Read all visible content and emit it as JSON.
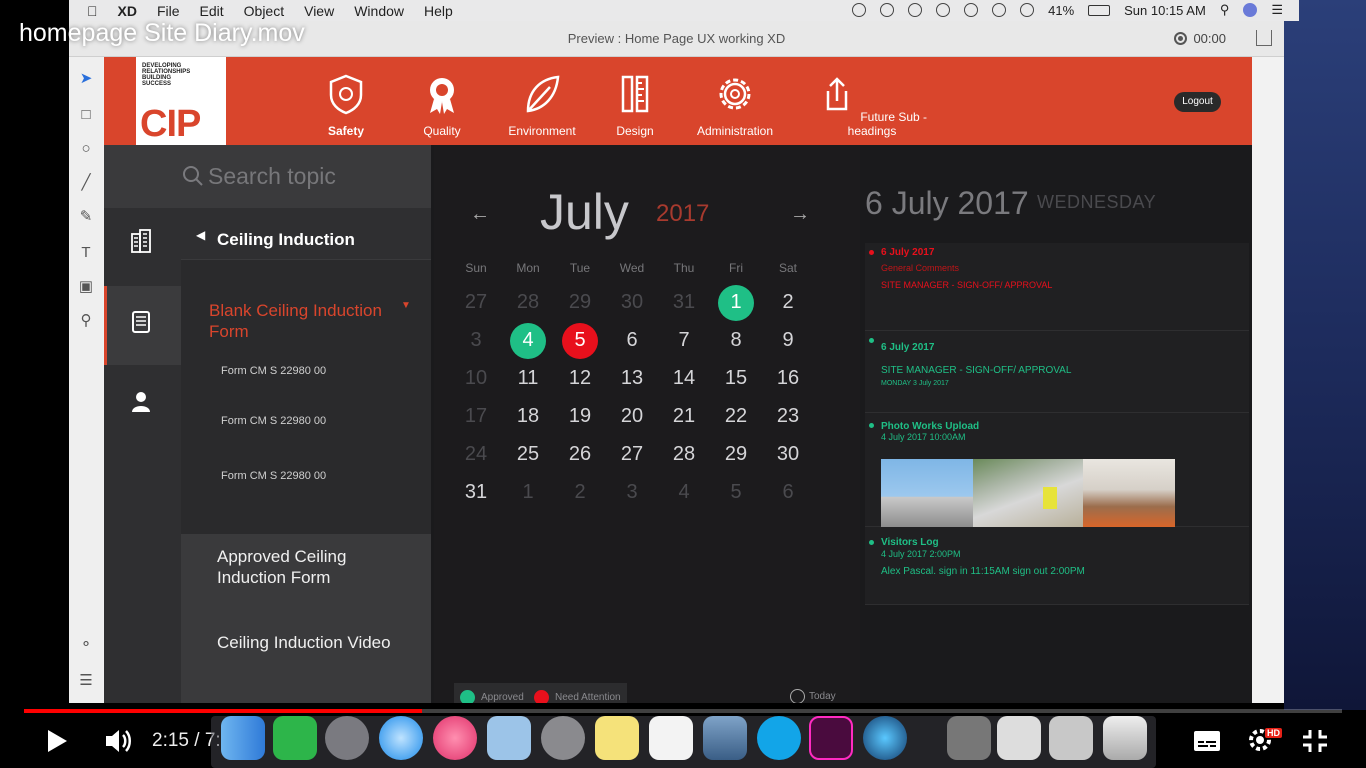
{
  "video": {
    "title": "homepage Site Diary.mov",
    "time": "2:15 / 7:30",
    "hd_badge": "HD",
    "progress_fraction": 0.302
  },
  "menubar": {
    "app": "XD",
    "items": [
      "File",
      "Edit",
      "Object",
      "View",
      "Window",
      "Help"
    ],
    "battery": "41%",
    "clock": "Sun 10:15 AM"
  },
  "window": {
    "title": "Preview : Home Page UX working XD",
    "timer": "00:00"
  },
  "header": {
    "logo_tagline": [
      "DEVELOPING",
      "RELATIONSHIPS",
      "BUILDING",
      "SUCCESS"
    ],
    "logo_text": "CIP",
    "nav": [
      {
        "label": "Safety",
        "icon": "shield-icon"
      },
      {
        "label": "Quality",
        "icon": "award-icon"
      },
      {
        "label": "Environment",
        "icon": "leaf-icon"
      },
      {
        "label": "Design",
        "icon": "ruler-pencil-icon"
      },
      {
        "label": "Administration",
        "icon": "gear-icon"
      },
      {
        "label": "Future Sub - headings",
        "icon": "share-icon"
      }
    ],
    "logout": "Logout"
  },
  "sidebar": {
    "search_placeholder": "Search topic",
    "section_title": "Ceiling Induction",
    "submenu_title": "Blank Ceiling Induction Form",
    "forms": [
      "Form CM S 22980 00",
      "Form CM S 22980 00",
      "Form CM S 22980 00"
    ],
    "links": [
      "Approved Ceiling Induction Form",
      "Ceiling Induction Video"
    ]
  },
  "calendar": {
    "month": "July",
    "year": "2017",
    "prev": "←",
    "next": "→",
    "weekdays": [
      "Sun",
      "Mon",
      "Tue",
      "Wed",
      "Thu",
      "Fri",
      "Sat"
    ],
    "rows": [
      [
        "27",
        "28",
        "29",
        "30",
        "31",
        "1",
        "2"
      ],
      [
        "3",
        "4",
        "5",
        "6",
        "7",
        "8",
        "9"
      ],
      [
        "10",
        "11",
        "12",
        "13",
        "14",
        "15",
        "16"
      ],
      [
        "17",
        "18",
        "19",
        "20",
        "21",
        "22",
        "23"
      ],
      [
        "24",
        "25",
        "26",
        "27",
        "28",
        "29",
        "30"
      ],
      [
        "31",
        "1",
        "2",
        "3",
        "4",
        "5",
        "6"
      ]
    ],
    "legend": {
      "approved": "Approved",
      "attention": "Need Attention",
      "today": "Today"
    },
    "colors": {
      "approved": "#1fbf86",
      "attention": "#e8101c"
    }
  },
  "day_panel": {
    "date": "6 July 2017",
    "weekday": "WEDNESDAY",
    "entries": [
      {
        "l1": "6 July 2017",
        "l2": "General Comments",
        "l3": "SITE MANAGER - SIGN-OFF/ APPROVAL",
        "color": "#e8101c"
      },
      {
        "l1": "6 July 2017",
        "l2": "SITE MANAGER - SIGN-OFF/ APPROVAL",
        "l3": "MONDAY 3 July 2017",
        "color": "#1fbf86"
      },
      {
        "l1": "Photo Works Upload",
        "l2": "4 July 2017 10:00AM",
        "color": "#1fbf86"
      },
      {
        "l1": "Visitors Log",
        "l2": "4 July 2017 2:00PM",
        "l3": "Alex Pascal. sign in 11:15AM sign out 2:00PM",
        "color": "#1fbf86"
      }
    ]
  }
}
